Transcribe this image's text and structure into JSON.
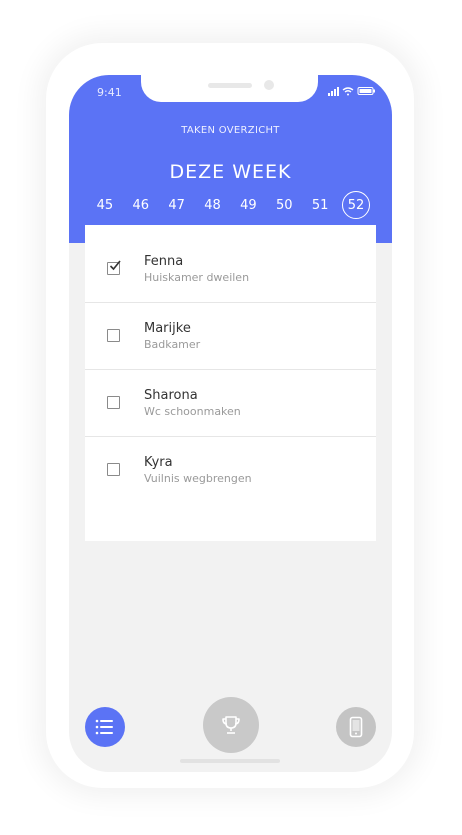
{
  "status_bar": {
    "time": "9:41",
    "icons": [
      "signal-icon",
      "wifi-icon",
      "battery-icon"
    ]
  },
  "header": {
    "title": "TAKEN OVERZICHT",
    "week_heading": "DEZE WEEK",
    "weeks": [
      "45",
      "46",
      "47",
      "48",
      "49",
      "50",
      "51",
      "52"
    ],
    "selected_week": "52"
  },
  "tasks": [
    {
      "name": "Fenna",
      "task": "Huiskamer dweilen",
      "done": true
    },
    {
      "name": "Marijke",
      "task": "Badkamer",
      "done": false
    },
    {
      "name": "Sharona",
      "task": "Wc schoonmaken",
      "done": false
    },
    {
      "name": "Kyra",
      "task": "Vuilnis wegbrengen",
      "done": false
    }
  ],
  "bottom_nav": {
    "items": [
      {
        "icon": "list-icon",
        "active": true
      },
      {
        "icon": "trophy-icon",
        "active": false
      },
      {
        "icon": "mobile-phone-icon",
        "active": false
      }
    ]
  },
  "colors": {
    "accent": "#5b73f5",
    "background": "#f2f2f2",
    "inactive_nav": "#c9c9c9"
  }
}
